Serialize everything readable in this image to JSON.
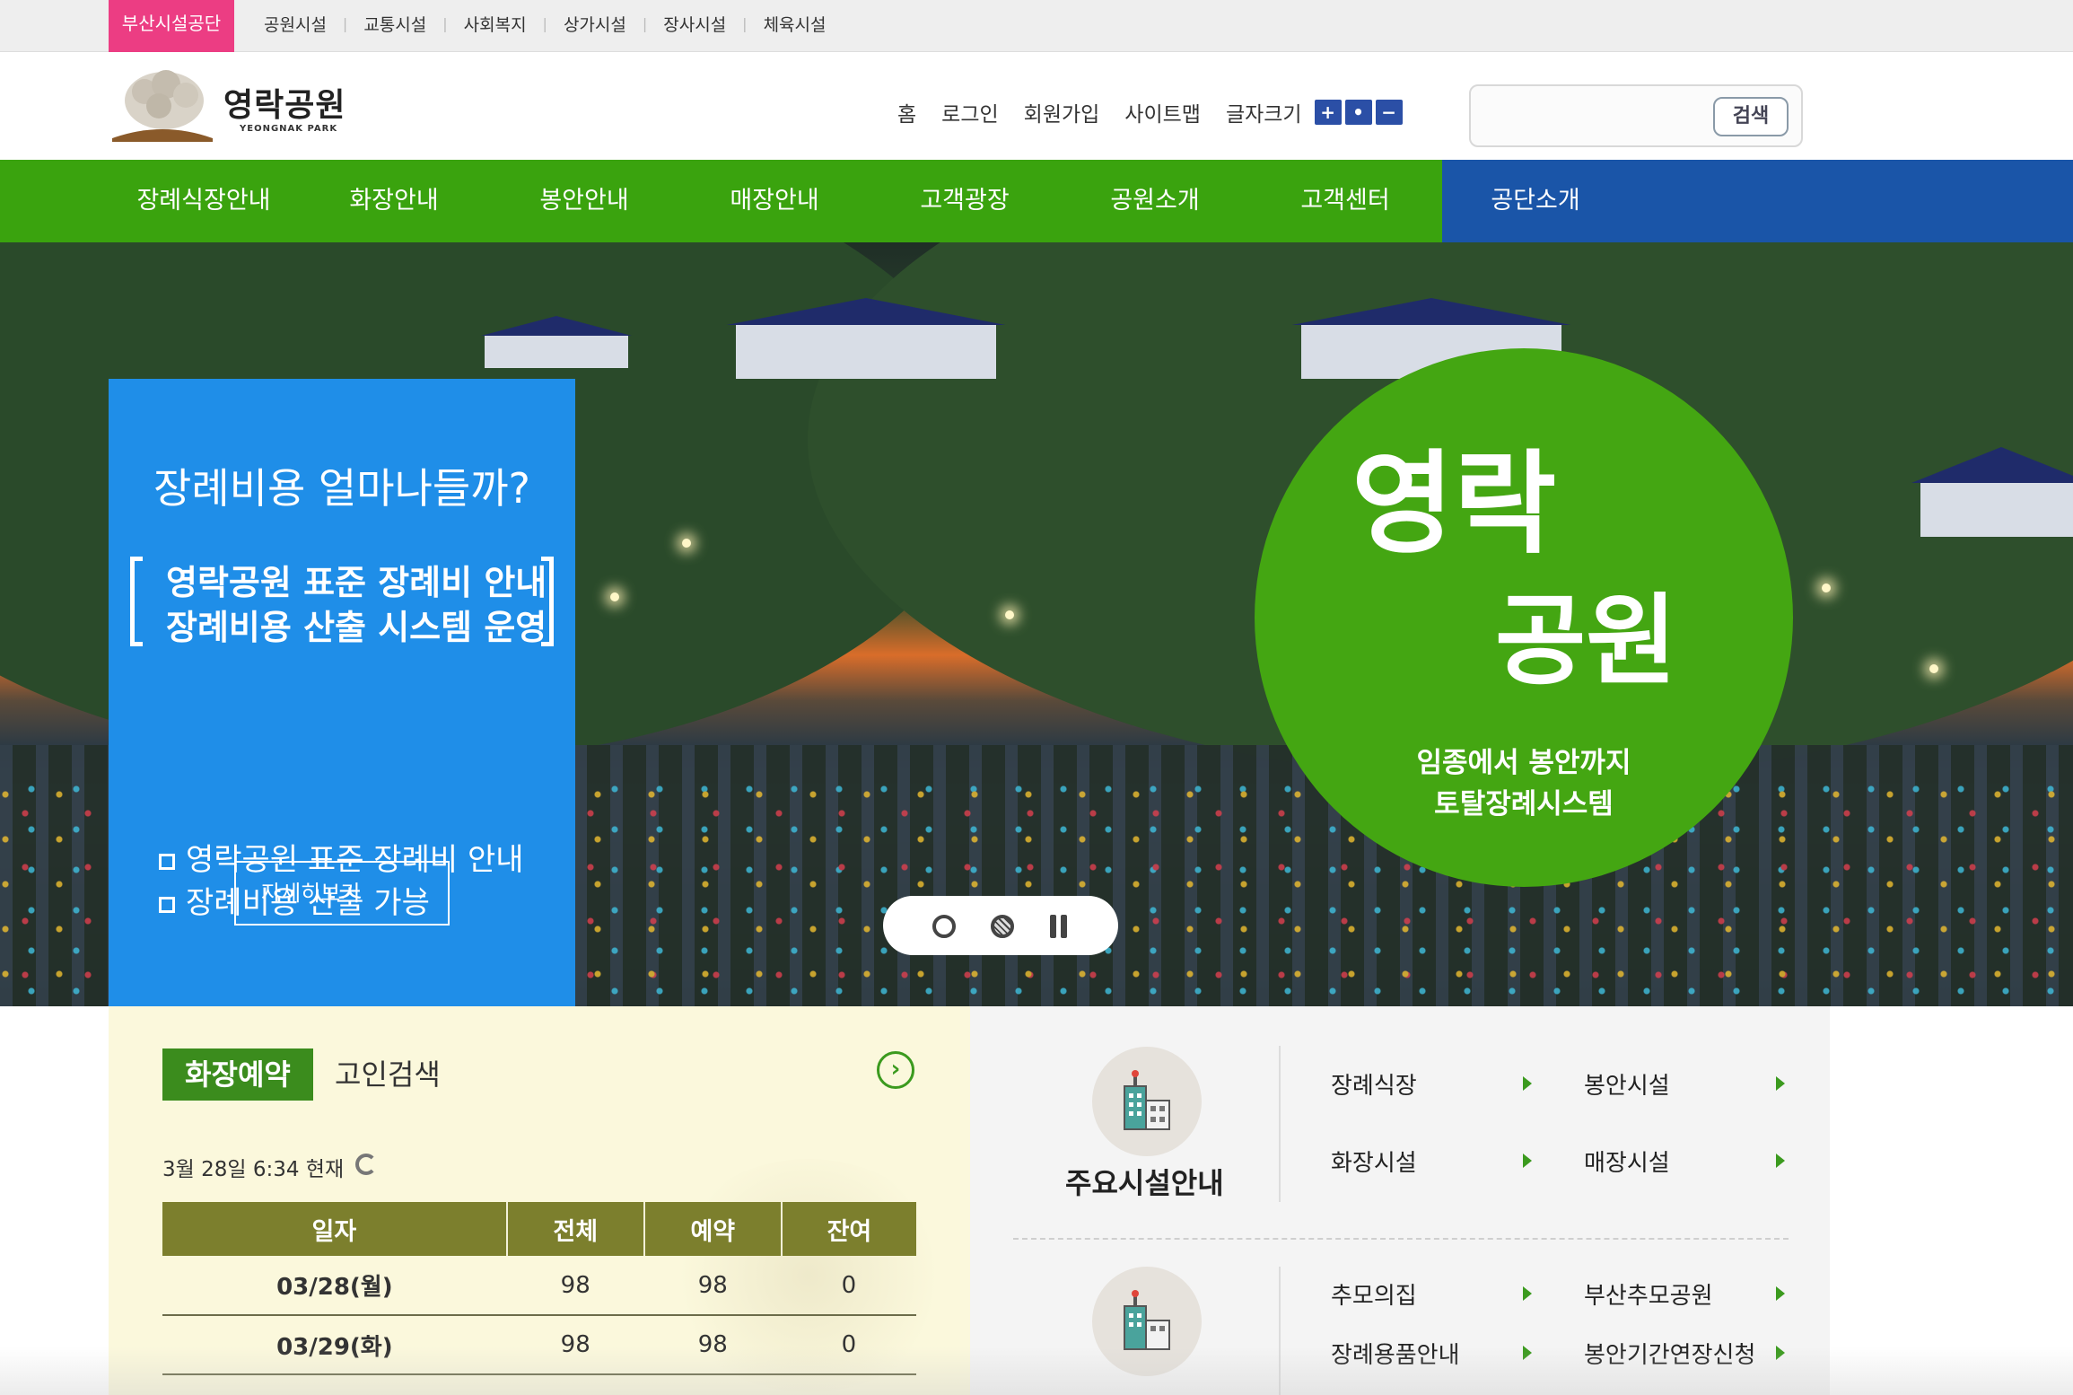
{
  "topbar": {
    "home": "부산시설공단",
    "links": [
      "공원시설",
      "교통시설",
      "사회복지",
      "상가시설",
      "장사시설",
      "체육시설"
    ]
  },
  "header": {
    "logo_name": "영락공원",
    "logo_sub": "YEONGNAK PARK",
    "util_links": [
      "홈",
      "로그인",
      "회원가입",
      "사이트맵",
      "글자크기"
    ],
    "fontsize_buttons": [
      "+",
      "•",
      "−"
    ],
    "search_placeholder": "",
    "search_button": "검색"
  },
  "nav": {
    "items": [
      "장례식장안내",
      "화장안내",
      "봉안안내",
      "매장안내",
      "고객광장",
      "공원소개",
      "고객센터",
      "공단소개"
    ]
  },
  "hero": {
    "promo_question": "장례비용 얼마나들까?",
    "promo_bracket_line1": "영락공원 표준 장례비 안내",
    "promo_bracket_line2": "장례비용 산출 시스템 운영",
    "promo_bullets": [
      "영락공원 표준 장례비 안내",
      "장례비용 산출 가능"
    ],
    "detail_button": "자세히보기",
    "circle_word1": "영락",
    "circle_word2": "공원",
    "circle_tag1": "임종에서 봉안까지",
    "circle_tag2": "토탈장례시스템"
  },
  "reserve": {
    "tab_active": "화장예약",
    "tab_other": "고인검색",
    "as_of": "3월 28일 6:34 현재",
    "columns": [
      "일자",
      "전체",
      "예약",
      "잔여"
    ],
    "rows": [
      {
        "date": "03/28(월)",
        "total": "98",
        "reserved": "98",
        "remaining": "0"
      },
      {
        "date": "03/29(화)",
        "total": "98",
        "reserved": "98",
        "remaining": "0"
      }
    ]
  },
  "facilities": {
    "group1_title": "주요시설안내",
    "group1_links": [
      "장례식장",
      "봉안시설",
      "화장시설",
      "매장시설"
    ],
    "group2_links": [
      "추모의집",
      "부산추모공원",
      "장례용품안내",
      "봉안기간연장신청"
    ]
  },
  "colors": {
    "accent_pink": "#ec3d83",
    "nav_green": "#3aa30e",
    "nav_blue": "#1a55a8",
    "promo_blue": "#1f8ee8",
    "circle_green": "#44a612",
    "table_header": "#7c7f2d"
  }
}
